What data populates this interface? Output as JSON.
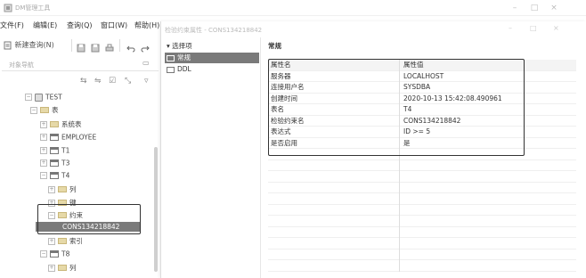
{
  "app": {
    "title": "DM管理工具",
    "window_controls": {
      "minimize": "–",
      "maximize": "□",
      "close": "×"
    }
  },
  "menu": [
    "文件(F)",
    "编辑(E)",
    "查询(Q)",
    "窗口(W)",
    "帮助(H)"
  ],
  "toolbar": {
    "new_query_label": "新建查询(N)"
  },
  "nav": {
    "tab_label": "对象导航",
    "tree": [
      {
        "label": "TEST",
        "icon": "database-icon"
      },
      {
        "label": "表",
        "icon": "folder-icon"
      },
      {
        "label": "系统表",
        "icon": "folder-icon"
      },
      {
        "label": "EMPLOYEE",
        "icon": "table-icon"
      },
      {
        "label": "T1",
        "icon": "table-icon"
      },
      {
        "label": "T3",
        "icon": "table-icon"
      },
      {
        "label": "T4",
        "icon": "table-icon"
      },
      {
        "label": "列",
        "icon": "folder-icon"
      },
      {
        "label": "键",
        "icon": "folder-icon"
      },
      {
        "label": "约束",
        "icon": "folder-icon"
      },
      {
        "label": "CONS134218842",
        "icon": "constraint-icon"
      },
      {
        "label": "索引",
        "icon": "folder-icon"
      },
      {
        "label": "T8",
        "icon": "table-icon"
      },
      {
        "label": "列",
        "icon": "folder-icon"
      }
    ]
  },
  "dialog": {
    "title": "检验约束属性 - CONS134218842",
    "options_header": "选择项",
    "options": [
      {
        "label": "常规",
        "active": true
      },
      {
        "label": "DDL",
        "active": false
      }
    ],
    "section_title": "常规",
    "columns": [
      "属性名",
      "属性值"
    ],
    "properties": [
      {
        "name": "服务器",
        "value": "LOCALHOST"
      },
      {
        "name": "连接用户名",
        "value": "SYSDBA"
      },
      {
        "name": "创建时间",
        "value": "2020-10-13 15:42:08.490961"
      },
      {
        "name": "表名",
        "value": "T4"
      },
      {
        "name": "检验约束名",
        "value": "CONS134218842"
      },
      {
        "name": "表达式",
        "value": "ID >= 5"
      },
      {
        "name": "是否启用",
        "value": "是"
      }
    ]
  },
  "colors": {
    "selection": "#7a7a7a",
    "callout": "#333333"
  }
}
